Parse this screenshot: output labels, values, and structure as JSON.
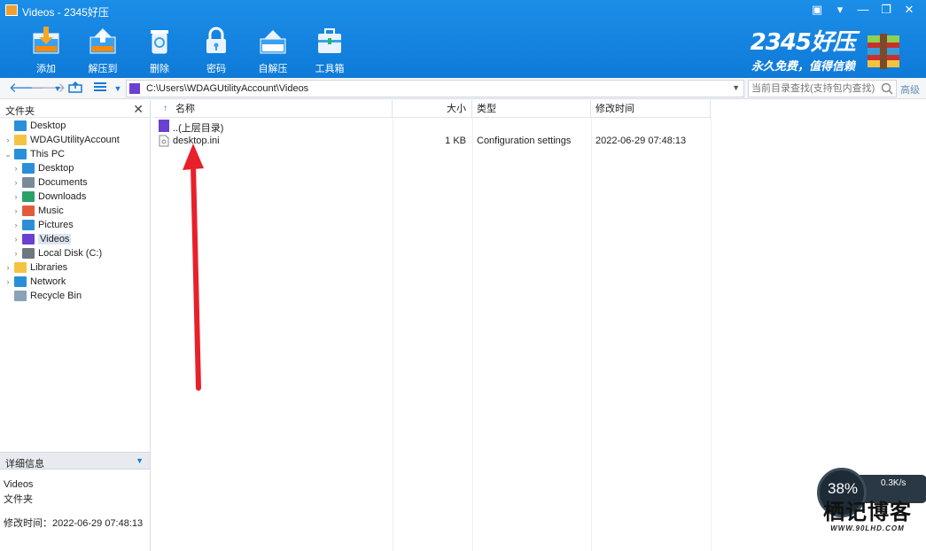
{
  "window": {
    "title": "Videos - 2345好压",
    "controls": [
      "▣",
      "▾",
      "—",
      "❐",
      "✕"
    ]
  },
  "toolbar": [
    {
      "label": "添加",
      "icon": "add-archive-icon"
    },
    {
      "label": "解压到",
      "icon": "extract-icon"
    },
    {
      "label": "删除",
      "icon": "delete-icon"
    },
    {
      "label": "密码",
      "icon": "password-lock-icon"
    },
    {
      "label": "自解压",
      "icon": "self-extract-icon"
    },
    {
      "label": "工具箱",
      "icon": "toolbox-icon"
    }
  ],
  "brand": {
    "name": "2345好压",
    "slogan": "永久免费，值得信赖"
  },
  "address": {
    "path": "C:\\Users\\WDAGUtilityAccount\\Videos",
    "search_placeholder": "当前目录查找(支持包内查找)",
    "advanced": "高级"
  },
  "folder_pane": {
    "title": "文件夹",
    "items": [
      {
        "label": "Desktop",
        "icon": "desktop-icon",
        "level": 0,
        "expand": ""
      },
      {
        "label": "WDAGUtilityAccount",
        "icon": "user-folder-icon",
        "level": 1,
        "expand": "›"
      },
      {
        "label": "This PC",
        "icon": "pc-icon",
        "level": 1,
        "expand": "⌄"
      },
      {
        "label": "Desktop",
        "icon": "desktop-folder-icon",
        "level": 2,
        "expand": "›"
      },
      {
        "label": "Documents",
        "icon": "documents-icon",
        "level": 2,
        "expand": "›"
      },
      {
        "label": "Downloads",
        "icon": "downloads-icon",
        "level": 2,
        "expand": "›"
      },
      {
        "label": "Music",
        "icon": "music-icon",
        "level": 2,
        "expand": "›"
      },
      {
        "label": "Pictures",
        "icon": "pictures-icon",
        "level": 2,
        "expand": "›"
      },
      {
        "label": "Videos",
        "icon": "videos-icon",
        "level": 2,
        "expand": "›",
        "selected": true
      },
      {
        "label": "Local Disk (C:)",
        "icon": "drive-icon",
        "level": 2,
        "expand": "›"
      },
      {
        "label": "Libraries",
        "icon": "libraries-icon",
        "level": 1,
        "expand": "›"
      },
      {
        "label": "Network",
        "icon": "network-icon",
        "level": 1,
        "expand": "›"
      },
      {
        "label": "Recycle Bin",
        "icon": "recycle-bin-icon",
        "level": 1,
        "expand": ""
      }
    ]
  },
  "details_pane": {
    "title": "详细信息",
    "name": "Videos",
    "type": "文件夹",
    "modified": "修改时间：2022-06-29 07:48:13"
  },
  "columns": {
    "name": "名称",
    "size": "大小",
    "type": "类型",
    "modified": "修改时间",
    "sort_indicator": "↑"
  },
  "files": [
    {
      "name": "..(上层目录)",
      "size": "",
      "type": "",
      "modified": "",
      "icon": "parent-folder-icon"
    },
    {
      "name": "desktop.ini",
      "size": "1 KB",
      "type": "Configuration settings",
      "modified": "2022-06-29 07:48:13",
      "icon": "ini-file-icon"
    }
  ],
  "speed_widget": {
    "percent": "38%",
    "rate": "0.3K/s"
  },
  "watermark": {
    "main": "栖记博客",
    "sub": "WWW.90LHD.COM"
  },
  "colors": {
    "header": "#1484e0",
    "accent": "#1a79d4",
    "annotation": "#e8202a"
  }
}
